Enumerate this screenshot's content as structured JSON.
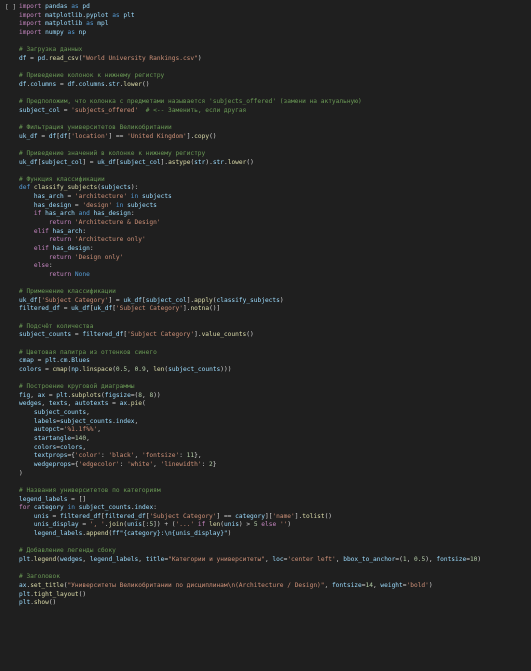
{
  "cell": {
    "run_indicator": "[ ]",
    "code_lines": [
      "import pandas as pd",
      "import matplotlib.pyplot as plt",
      "import matplotlib as mpl",
      "import numpy as np",
      "",
      "# Загрузка данных",
      "df = pd.read_csv(\"World University Rankings.csv\")",
      "",
      "# Приведение колонок к нижнему регистру",
      "df.columns = df.columns.str.lower()",
      "",
      "# Предположим, что колонка с предметами называется 'subjects_offered' (замени на актуальную)",
      "subject_col = 'subjects_offered'  # <-- Заменить, если другая",
      "",
      "# Фильтрация университетов Великобритании",
      "uk_df = df[df['location'] == 'United Kingdom'].copy()",
      "",
      "# Приведение значений в колонке к нижнему регистру",
      "uk_df[subject_col] = uk_df[subject_col].astype(str).str.lower()",
      "",
      "# Функция классификации",
      "def classify_subjects(subjects):",
      "    has_arch = 'architecture' in subjects",
      "    has_design = 'design' in subjects",
      "    if has_arch and has_design:",
      "        return 'Architecture & Design'",
      "    elif has_arch:",
      "        return 'Architecture only'",
      "    elif has_design:",
      "        return 'Design only'",
      "    else:",
      "        return None",
      "",
      "# Применение классификации",
      "uk_df['Subject Category'] = uk_df[subject_col].apply(classify_subjects)",
      "filtered_df = uk_df[uk_df['Subject Category'].notna()]",
      "",
      "# Подсчёт количества",
      "subject_counts = filtered_df['Subject Category'].value_counts()",
      "",
      "# Цветовая палитра из оттенков синего",
      "cmap = plt.cm.Blues",
      "colors = cmap(np.linspace(0.5, 0.9, len(subject_counts)))",
      "",
      "# Построение круговой диаграммы",
      "fig, ax = plt.subplots(figsize=(8, 8))",
      "wedges, texts, autotexts = ax.pie(",
      "    subject_counts,",
      "    labels=subject_counts.index,",
      "    autopct='%1.1f%%',",
      "    startangle=140,",
      "    colors=colors,",
      "    textprops={'color': 'black', 'fontsize': 11},",
      "    wedgeprops={'edgecolor': 'white', 'linewidth': 2}",
      ")",
      "",
      "# Названия университетов по категориям",
      "legend_labels = []",
      "for category in subject_counts.index:",
      "    unis = filtered_df[filtered_df['Subject Category'] == category]['name'].tolist()",
      "    unis_display = ', '.join(unis[:5]) + ('...' if len(unis) > 5 else '')",
      "    legend_labels.append(f\"{category}:\\n{unis_display}\")",
      "",
      "# Добавление легенды сбоку",
      "plt.legend(wedges, legend_labels, title=\"Категории и университеты\", loc='center left', bbox_to_anchor=(1, 0.5), fontsize=10)",
      "",
      "# Заголовок",
      "ax.set_title(\"Университеты Великобритании по дисциплинам\\n(Architecture / Design)\", fontsize=14, weight='bold')",
      "plt.tight_layout()",
      "plt.show()"
    ]
  },
  "colors": {
    "background": "#1f1f1f",
    "keyword": "#569cd6",
    "control": "#c586c0",
    "string": "#ce9178",
    "comment": "#6a9955",
    "number": "#b5cea8",
    "function": "#dcdcaa",
    "variable": "#9cdcfe"
  }
}
